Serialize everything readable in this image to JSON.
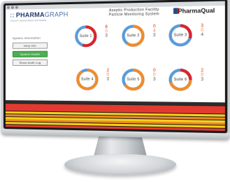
{
  "app": {
    "logo_text": "PHARMA",
    "logo_sub": "GRAPH",
    "tagline": "FACILITY MONITORING SOFTWARE",
    "title_line1": "Aseptic Production Facility",
    "title_line2": "Particle Monitoring System",
    "brand": "PharmaQual"
  },
  "sidebar": {
    "section_label": "System Information",
    "buttons": [
      {
        "label": "Help Info",
        "state": "normal"
      },
      {
        "label": "System Health",
        "state": "active"
      },
      {
        "label": "Show Audit Log",
        "state": "normal"
      }
    ]
  },
  "suites": [
    {
      "label": "Suite 1",
      "alarms": "6",
      "alerts": "0",
      "counters": "3",
      "alarm_fraction": 0.55,
      "alert_fraction": 0.0
    },
    {
      "label": "Suite 2",
      "alarms": "0",
      "alerts": "4",
      "counters": "3",
      "alarm_fraction": 0.0,
      "alert_fraction": 0.6
    },
    {
      "label": "Suite 3",
      "alarms": "3",
      "alerts": "0",
      "counters": "4",
      "alarm_fraction": 0.3,
      "alert_fraction": 0.0
    },
    {
      "label": "Suite 4",
      "alarms": "2",
      "alerts": "0",
      "counters": "3",
      "alarm_fraction": 0.0,
      "alert_fraction": 0.9
    },
    {
      "label": "Suite 5",
      "alarms": "0",
      "alerts": "0",
      "counters": "3",
      "alarm_fraction": 0.0,
      "alert_fraction": 0.65
    },
    {
      "label": "Suite 6",
      "alarms": "2",
      "alerts": "0",
      "counters": "3",
      "alarm_fraction": 0.25,
      "alert_fraction": 0.45
    }
  ],
  "colors": {
    "alarm": "#d9242a",
    "alert": "#ef8b2c",
    "normal": "#5a9bd8",
    "active_button": "#4caf50"
  },
  "alarm_table": {
    "rows": [
      "red",
      "red",
      "red",
      "yellow",
      "orange",
      "yellow",
      "orange",
      "yellow",
      "red",
      "yellow"
    ]
  }
}
